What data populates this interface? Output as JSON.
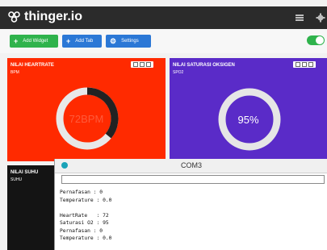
{
  "header": {
    "app_name": "thinger.io",
    "logo_icon": "thinger-logo-icon",
    "menu_icon": "hamburger-menu-icon",
    "settings_icon": "gear-icon"
  },
  "toolbar": {
    "add_widget_label": "Add Widget",
    "add_tab_label": "Add Tab",
    "settings_label": "Settings",
    "add_widget_color": "#2fb34c",
    "add_tab_color": "#2b78d6",
    "settings_color": "#2b78d6",
    "toggle_color": "#2fb34c",
    "toggle_on": true
  },
  "widgets": {
    "heartrate": {
      "title": "NILAI HEARTRATE",
      "subtitle": "BPM",
      "value_text": "72BPM",
      "value": 72,
      "fraction": 0.36,
      "bg_color": "#ff2a00",
      "arc_color": "#222222"
    },
    "spo2": {
      "title": "NILAI SATURASI OKSIGEN",
      "subtitle": "SPO2",
      "value_text": "95%",
      "value": 95,
      "fraction": 1.0,
      "bg_color": "#5a2bc8",
      "arc_color": "#e6e6e6"
    },
    "suhu": {
      "title": "NILAI SUHU",
      "subtitle": "SUHU",
      "bg_color": "#141414"
    }
  },
  "serial_monitor": {
    "title": "COM3",
    "lines": [
      "Pernafasan : 0",
      "Temperature : 0.0",
      "",
      "HeartRate   : 72",
      "Saturasi O2 : 95",
      "Pernafasan : 0",
      "Temperature : 0.0"
    ]
  }
}
